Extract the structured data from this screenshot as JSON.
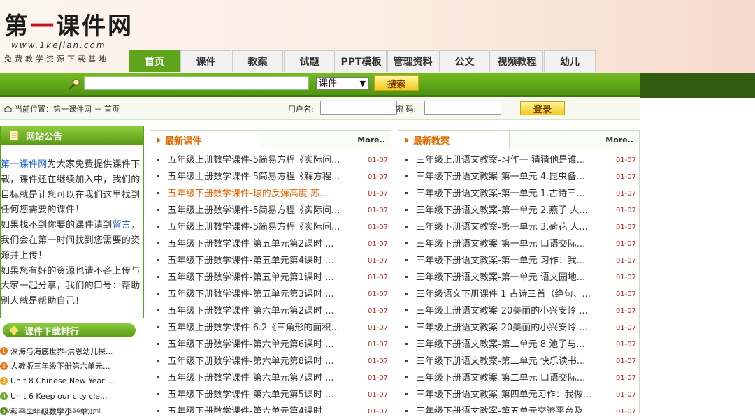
{
  "logo": {
    "title_part1": "第",
    "title_part2": "一",
    "title_part3": "课件网",
    "url": "www.1kejian.com",
    "slogan": "免费教学资源下载基地"
  },
  "nav": {
    "items": [
      {
        "label": "首页",
        "active": true
      },
      {
        "label": "课件"
      },
      {
        "label": "教案"
      },
      {
        "label": "试题"
      },
      {
        "label": "PPT模板"
      },
      {
        "label": "管理资料"
      },
      {
        "label": "公文"
      },
      {
        "label": "视频教程"
      },
      {
        "label": "幼儿"
      }
    ]
  },
  "search": {
    "input_value": "",
    "select_value": "课件",
    "button_label": "搜索"
  },
  "location": {
    "text": "当前位置：第一课件网 － 首页"
  },
  "login": {
    "user_label": "用户名:",
    "password_label": "密 码:",
    "button_label": "登录"
  },
  "notice": {
    "title": "网站公告",
    "body_link": "第一课件网",
    "body_part1": "为大家免费提供课件下载，课件还在继续加入中，我们的目标就是让您可以在我们这里找到任何您需要的课件！",
    "body_part2": "如果找不到你要的课件请到",
    "body_link2": "留言",
    "body_part3": "，我们会在第一时间找到您需要的资源并上传！",
    "body_part4": "如果您有好的资源也请不吝上传与大家一起分享，我们的口号：帮助别人就是帮助自己！"
  },
  "ranking": {
    "title": "课件下载排行",
    "items": [
      {
        "num": "1",
        "label": "深海与海底世界-洪恩幼儿探..."
      },
      {
        "num": "2",
        "label": "人教版三年级下册第六单元..."
      },
      {
        "num": "3",
        "label": "Unit 8 Chinese New Year ..."
      },
      {
        "num": "4",
        "label": "Unit 6 Keep our city cle..."
      },
      {
        "num": "5",
        "label": "和平二年级数学小一单..."
      }
    ]
  },
  "courseware": {
    "title": "最新课件",
    "more": "More..",
    "items": [
      {
        "title": "五年级上册数学课件-5简易方程《实际问...",
        "date": "01-07"
      },
      {
        "title": "五年级上册数学课件-5简易方程《解方程...",
        "date": "01-07"
      },
      {
        "title": "五年级下册数学课件-球的反弹高度 苏...",
        "date": "01-07",
        "highlight": true
      },
      {
        "title": "五年级上册数学课件-5简易方程《实际问...",
        "date": "01-07"
      },
      {
        "title": "五年级上册数学课件-5简易方程《实际问...",
        "date": "01-07"
      },
      {
        "title": "五年级下册数学课件-第五单元第2课时 ...",
        "date": "01-07"
      },
      {
        "title": "五年级下册数学课件-第五单元第4课时 ...",
        "date": "01-07"
      },
      {
        "title": "五年级下册数学课件-第五单元第1课时 ...",
        "date": "01-07"
      },
      {
        "title": "五年级下册数学课件-第五单元第3课时 ...",
        "date": "01-07"
      },
      {
        "title": "五年级下册数学课件-第六单元第2课时 ...",
        "date": "01-07"
      },
      {
        "title": "五年级上册数学课件-6.2《三角形的面积...",
        "date": "01-07"
      },
      {
        "title": "五年级下册数学课件-第六单元第6课时 ...",
        "date": "01-07"
      },
      {
        "title": "五年级下册数学课件-第六单元第8课时 ...",
        "date": "01-07"
      },
      {
        "title": "五年级下册数学课件-第六单元第7课时 ...",
        "date": "01-07"
      },
      {
        "title": "五年级下册数学课件-第六单元第5课时 ...",
        "date": "01-07"
      },
      {
        "title": "五年级下册数学课件-第六单元第4课时 ...",
        "date": "01-07"
      }
    ]
  },
  "lessons": {
    "title": "最新教案",
    "more": "More..",
    "items": [
      {
        "title": "三年级上册语文教案-习作一 猜猜他是谁...",
        "date": "01-07"
      },
      {
        "title": "三年级下册语文教案-第一单元 4.昆虫备...",
        "date": "01-07"
      },
      {
        "title": "三年级下册语文教案-第一单元 1.古诗三...",
        "date": "01-07"
      },
      {
        "title": "三年级下册语文教案-第一单元 2.燕子 人...",
        "date": "01-07"
      },
      {
        "title": "三年级下册语文教案-第一单元 3.荷花 人...",
        "date": "01-07"
      },
      {
        "title": "三年级下册语文教案-第一单元 口语交际...",
        "date": "01-07"
      },
      {
        "title": "三年级下册语文教案-第一单元 习作：我...",
        "date": "01-07"
      },
      {
        "title": "三年级下册语文教案-第一单元 语文园地...",
        "date": "01-07"
      },
      {
        "title": "三年级语文下册课件 1 古诗三首（绝句、...",
        "date": "01-07"
      },
      {
        "title": "三年级上册语文教案-20美丽的小兴安岭 ...",
        "date": "01-07"
      },
      {
        "title": "三年级上册语文教案-20美丽的小兴安岭 ...",
        "date": "01-07"
      },
      {
        "title": "三年级下册语文教案-第二单元 8 池子与...",
        "date": "01-07"
      },
      {
        "title": "三年级下册语文教案-第二单元 快乐读书...",
        "date": "01-07"
      },
      {
        "title": "三年级下册语文教案-第二单元 口语交际...",
        "date": "01-07"
      },
      {
        "title": "三年级下册语文教案-第四单元习作：我做...",
        "date": "01-07"
      },
      {
        "title": "三年级下册语文教案-第五单元交流平台及...",
        "date": "01-07"
      }
    ]
  },
  "footer": {
    "url": "17/2238/20220107175566.html"
  },
  "colors": {
    "brand_green": "#5ea51b",
    "accent_orange": "#e06a00",
    "date_red": "#c81e1e",
    "link_blue": "#1e64c8",
    "rank_colors": [
      "#e8701a",
      "#e8701a",
      "#e8a01a",
      "#6aa82a",
      "#5a9b17"
    ]
  }
}
